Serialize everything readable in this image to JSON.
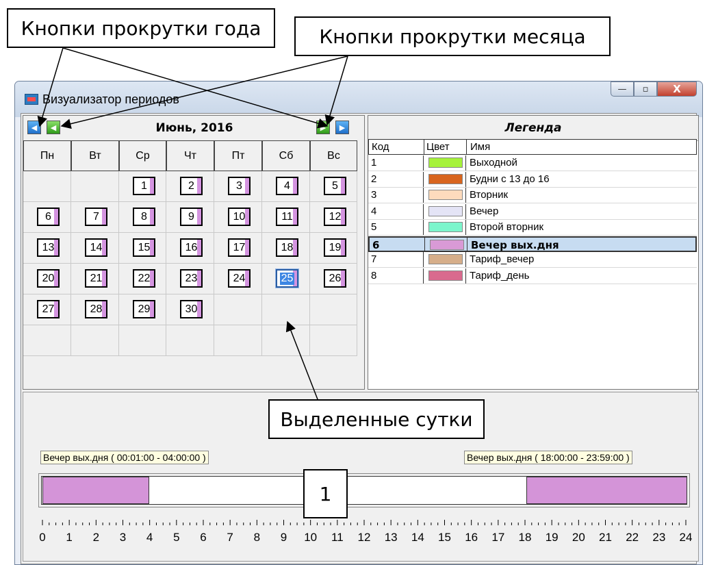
{
  "annotations": {
    "year_buttons": "Кнопки прокрутки года",
    "month_buttons": "Кнопки прокрутки месяца",
    "selected_day": "Выделенные сутки",
    "marker": "1"
  },
  "window": {
    "title": "Визуализатор периодов",
    "buttons": {
      "minimize": "—",
      "maximize": "▫",
      "close": "X"
    }
  },
  "calendar": {
    "month_label": "Июнь, 2016",
    "nav": {
      "year_prev": "◀",
      "month_prev": "◀",
      "month_next": "▶",
      "year_next": "▶"
    },
    "weekdays": [
      "Пн",
      "Вт",
      "Ср",
      "Чт",
      "Пт",
      "Сб",
      "Вс"
    ],
    "days": [
      "1",
      "2",
      "3",
      "4",
      "5",
      "6",
      "7",
      "8",
      "9",
      "10",
      "11",
      "12",
      "13",
      "14",
      "15",
      "16",
      "17",
      "18",
      "19",
      "20",
      "21",
      "22",
      "23",
      "24",
      "25",
      "26",
      "27",
      "28",
      "29",
      "30"
    ],
    "first_weekday_index": 2,
    "selected_day": "25"
  },
  "legend": {
    "title": "Легенда",
    "columns": [
      "Код",
      "Цвет",
      "Имя"
    ],
    "rows": [
      {
        "code": "1",
        "color": "#a6f23a",
        "name": "Выходной"
      },
      {
        "code": "2",
        "color": "#d8651e",
        "name": "Будни с 13 до 16"
      },
      {
        "code": "3",
        "color": "#fddbbd",
        "name": "Вторник"
      },
      {
        "code": "4",
        "color": "#e4e4f6",
        "name": "Вечер"
      },
      {
        "code": "5",
        "color": "#7cf5cc",
        "name": "Второй вторник"
      },
      {
        "code": "6",
        "color": "#d99ad6",
        "name": "Вечер вых.дня"
      },
      {
        "code": "7",
        "color": "#d6ae8a",
        "name": "Тариф_вечер"
      },
      {
        "code": "8",
        "color": "#d96a8e",
        "name": "Тариф_день"
      }
    ],
    "selected_row": "6"
  },
  "timeline": {
    "segments": [
      {
        "start_hour": 0.0167,
        "end_hour": 4.0,
        "color": "#d494d8",
        "tooltip": "Вечер вых.дня ( 00:01:00 - 04:00:00 )"
      },
      {
        "start_hour": 18.0,
        "end_hour": 23.9833,
        "color": "#d494d8",
        "tooltip": "Вечер вых.дня ( 18:00:00 - 23:59:00 )"
      }
    ],
    "hour_labels": [
      "0",
      "1",
      "2",
      "3",
      "4",
      "5",
      "6",
      "7",
      "8",
      "9",
      "10",
      "11",
      "12",
      "13",
      "14",
      "15",
      "16",
      "17",
      "18",
      "19",
      "20",
      "21",
      "22",
      "23",
      "24"
    ]
  }
}
